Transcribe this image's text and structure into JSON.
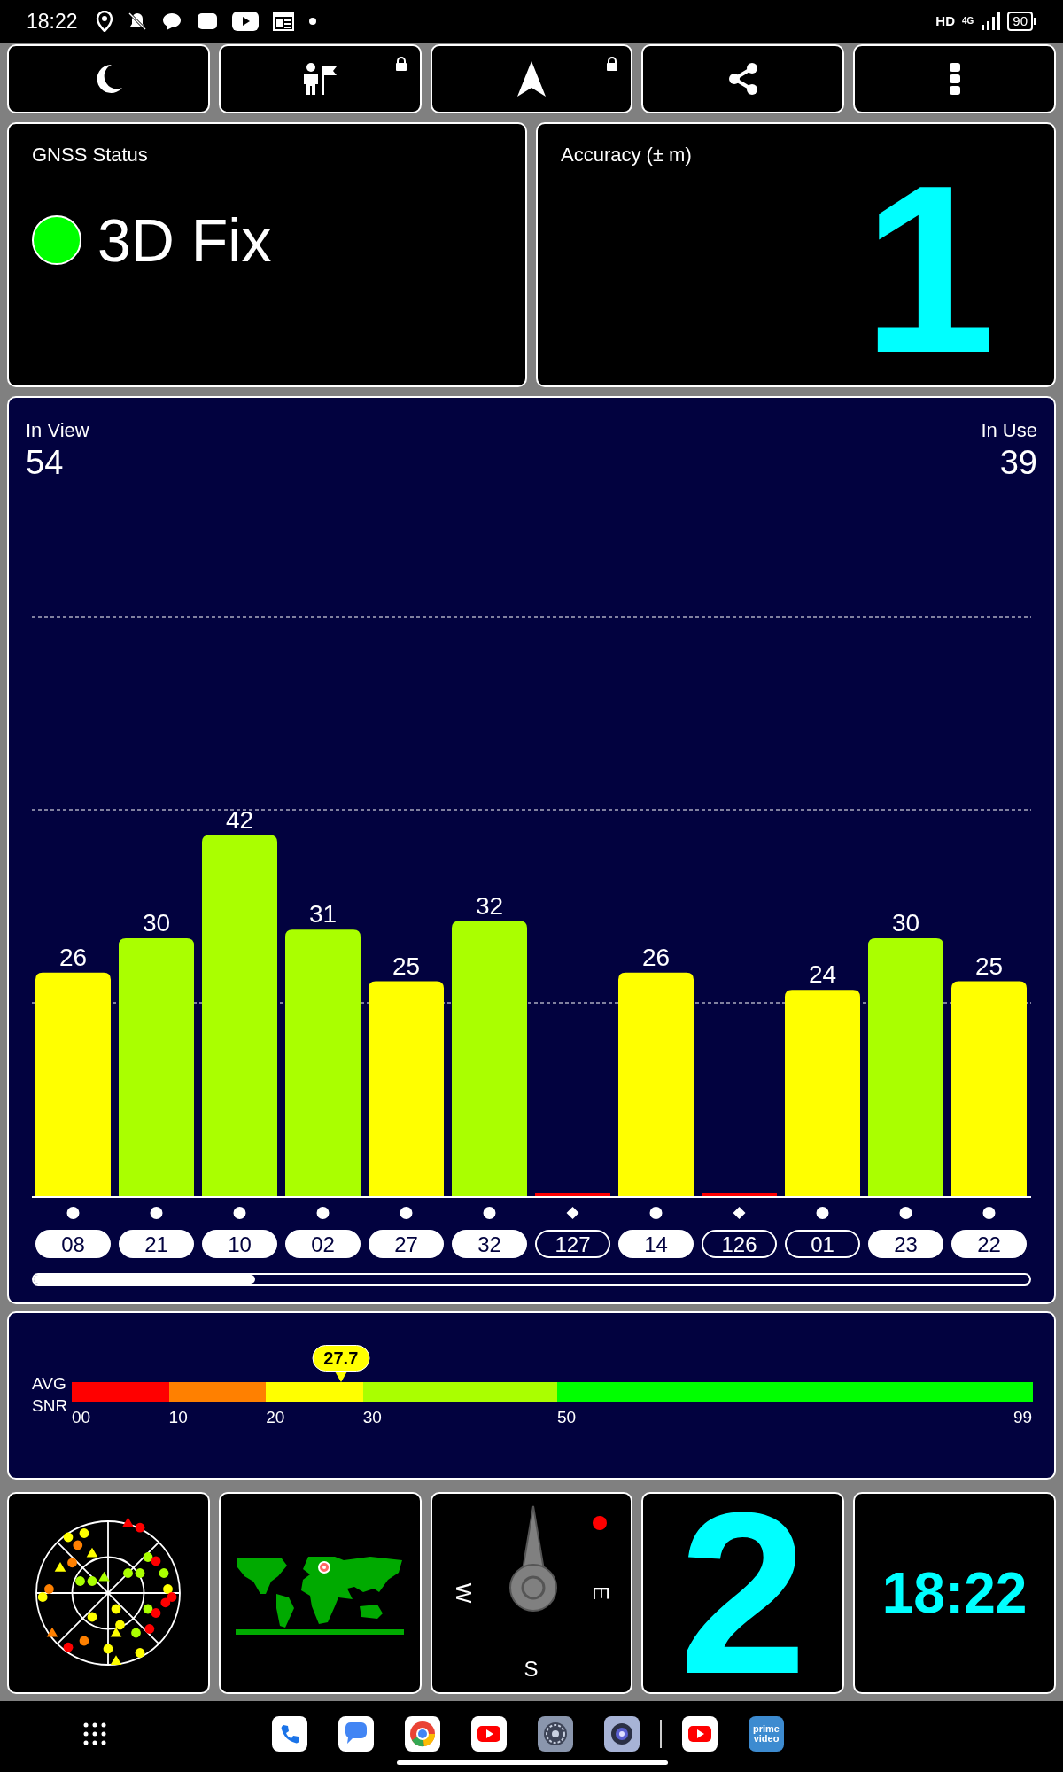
{
  "status_bar": {
    "time": "18:22",
    "network": "HD",
    "network_type": "4G",
    "battery": "90"
  },
  "toolbar": [
    {
      "kind": "moon",
      "locked": false
    },
    {
      "kind": "person_flag",
      "locked": true
    },
    {
      "kind": "navigate",
      "locked": true
    },
    {
      "kind": "share",
      "locked": false
    },
    {
      "kind": "more",
      "locked": false
    }
  ],
  "gnss_status": {
    "title": "GNSS Status",
    "fix": "3D Fix",
    "color": "#00ff00"
  },
  "accuracy": {
    "title": "Accuracy (± m)",
    "value": "1"
  },
  "satellites": {
    "in_view_label": "In View",
    "in_view": "54",
    "in_use_label": "In Use",
    "in_use": "39",
    "chart_data": {
      "type": "bar",
      "categories": [
        "08",
        "21",
        "10",
        "02",
        "27",
        "32",
        "127",
        "14",
        "126",
        "01",
        "23",
        "22"
      ],
      "values": [
        26,
        30,
        42,
        31,
        25,
        32,
        0.4,
        26,
        0.4,
        24,
        30,
        25
      ],
      "value_labels": [
        "26",
        "30",
        "42",
        "31",
        "25",
        "32",
        null,
        "26",
        null,
        "24",
        "30",
        "25"
      ]
    },
    "markers": [
      {
        "kind": "circle",
        "in_use": true
      },
      {
        "kind": "circle",
        "in_use": true
      },
      {
        "kind": "circle",
        "in_use": true
      },
      {
        "kind": "circle",
        "in_use": true
      },
      {
        "kind": "circle",
        "in_use": true
      },
      {
        "kind": "circle",
        "in_use": true
      },
      {
        "kind": "diamond",
        "in_use": false
      },
      {
        "kind": "circle",
        "in_use": true
      },
      {
        "kind": "diamond",
        "in_use": false
      },
      {
        "kind": "circle",
        "in_use": false
      },
      {
        "kind": "circle",
        "in_use": true
      },
      {
        "kind": "circle",
        "in_use": true
      }
    ]
  },
  "snr": {
    "label_top": "AVG",
    "label_bottom": "SNR",
    "average": "27.7",
    "level": 0.28,
    "segments": [
      {
        "color": "#ff0000"
      },
      {
        "color": "#ff8000"
      },
      {
        "color": "#ffff00"
      },
      {
        "color": "#aaff00"
      },
      {
        "color": "#00ff00"
      }
    ],
    "ticks": [
      "00",
      "10",
      "20",
      "30",
      "50",
      "99"
    ]
  },
  "tiles": {
    "compass": [
      "W",
      "E",
      "S"
    ],
    "count": "2",
    "clock": "18:22"
  },
  "dock": [
    {
      "kind": "apps"
    },
    {
      "kind": "phone"
    },
    {
      "kind": "messages"
    },
    {
      "kind": "browser"
    },
    {
      "kind": "video"
    },
    {
      "kind": "settings"
    },
    {
      "kind": "camera"
    },
    {
      "kind": "divider"
    },
    {
      "kind": "video"
    },
    {
      "kind": "prime",
      "label": "prime video"
    }
  ]
}
